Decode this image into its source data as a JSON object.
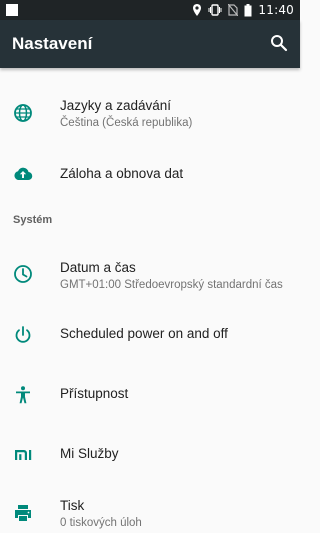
{
  "status_bar": {
    "time": "11:40"
  },
  "toolbar": {
    "title": "Nastavení"
  },
  "items": [
    {
      "icon": "globe-icon",
      "title": "Jazyky a zadávání",
      "subtitle": "Čeština (Česká republika)"
    },
    {
      "icon": "cloud-upload-icon",
      "title": "Záloha a obnova dat",
      "subtitle": ""
    }
  ],
  "section_system": "Systém",
  "system_items": [
    {
      "icon": "clock-icon",
      "title": "Datum a čas",
      "subtitle": "GMT+01:00 Středoevropský standardní čas"
    },
    {
      "icon": "power-icon",
      "title": "Scheduled power on and off",
      "subtitle": ""
    },
    {
      "icon": "accessibility-icon",
      "title": "Přístupnost",
      "subtitle": ""
    },
    {
      "icon": "mi-icon",
      "title": "Mi Služby",
      "subtitle": ""
    },
    {
      "icon": "printer-icon",
      "title": "Tisk",
      "subtitle": "0 tiskových úloh"
    }
  ],
  "colors": {
    "accent": "#00897b",
    "toolbar": "#263238",
    "statusbar": "#1f2426"
  }
}
